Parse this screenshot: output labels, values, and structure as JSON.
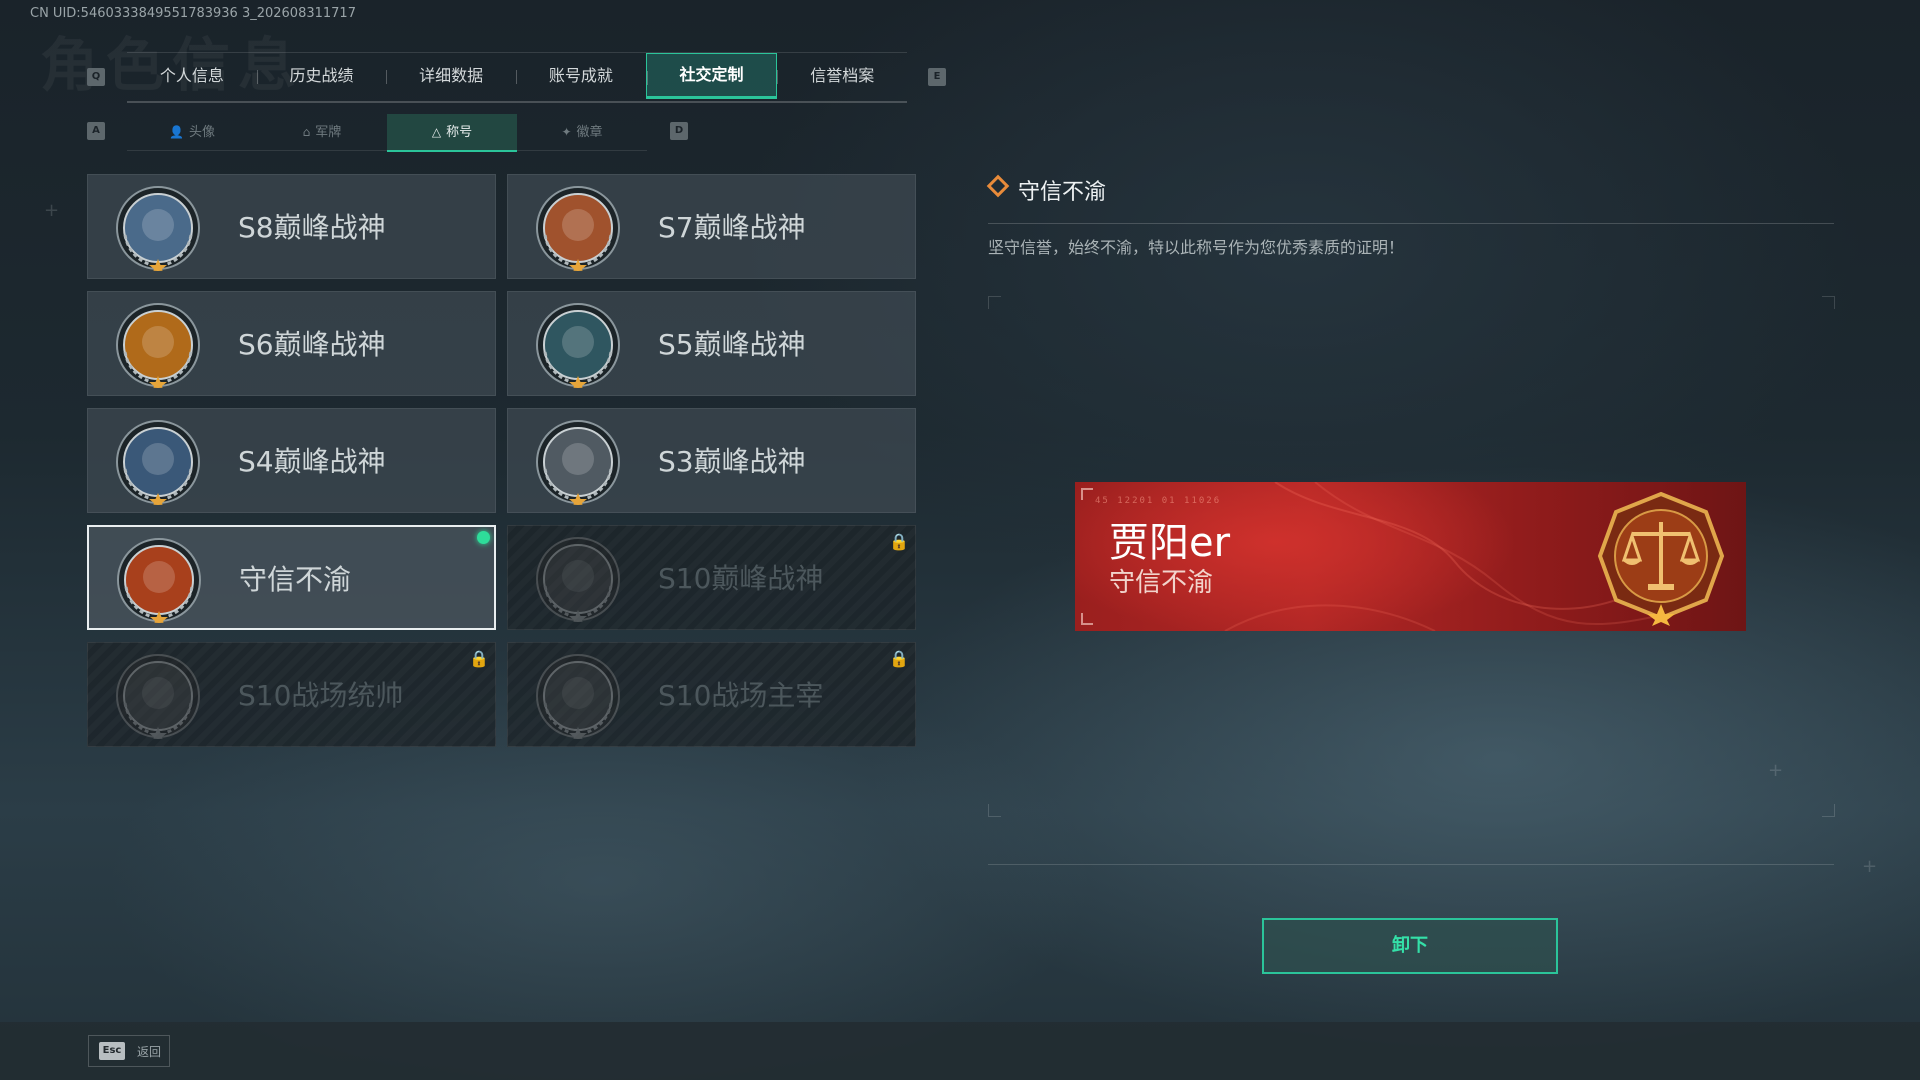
{
  "uid_text": "CN UID:5460333849551783936 3_202608311717",
  "bg_title": "角色信息",
  "keys": {
    "prev_tab": "Q",
    "next_tab": "E",
    "prev_sub": "A",
    "next_sub": "D"
  },
  "tabs": [
    {
      "label": "个人信息"
    },
    {
      "label": "历史战绩"
    },
    {
      "label": "详细数据"
    },
    {
      "label": "账号成就"
    },
    {
      "label": "社交定制",
      "active": true
    },
    {
      "label": "信誉档案"
    }
  ],
  "subtabs": [
    {
      "label": "头像",
      "icon": "person-icon"
    },
    {
      "label": "军牌",
      "icon": "dogtag-icon"
    },
    {
      "label": "称号",
      "icon": "triangle-icon",
      "active": true
    },
    {
      "label": "徽章",
      "icon": "badge-icon"
    }
  ],
  "cards": [
    {
      "name": "S8巅峰战神",
      "medal": "s8-medal",
      "color": "#4a6a8a"
    },
    {
      "name": "S7巅峰战神",
      "medal": "s7-medal",
      "color": "#a0522d"
    },
    {
      "name": "S6巅峰战神",
      "medal": "s6-medal",
      "color": "#b06a1a"
    },
    {
      "name": "S5巅峰战神",
      "medal": "s5-medal",
      "color": "#2f5660"
    },
    {
      "name": "S4巅峰战神",
      "medal": "s4-medal",
      "color": "#3a5878"
    },
    {
      "name": "S3巅峰战神",
      "medal": "s3-medal",
      "color": "#505a62"
    },
    {
      "name": "守信不渝",
      "medal": "justice-scale-medal",
      "color": "#a8401c",
      "selected": true,
      "equipped": true
    },
    {
      "name": "S10巅峰战神",
      "medal": "s10-medal",
      "color": "#3a4a56",
      "locked": true
    },
    {
      "name": "S10战场统帅",
      "medal": "s10-commander-medal",
      "color": "#3a4a56",
      "locked": true
    },
    {
      "name": "S10战场主宰",
      "medal": "s10-ruler-medal",
      "color": "#3a4a56",
      "locked": true
    }
  ],
  "detail": {
    "title": "守信不渝",
    "description": "坚守信誉，始终不渝，特以此称号作为您优秀素质的证明！"
  },
  "banner": {
    "player_name": "贾阳er",
    "title": "守信不渝",
    "code": "45 12201   01 11026"
  },
  "unequip_label": "卸下",
  "esc": {
    "key": "Esc",
    "label": "返回"
  }
}
